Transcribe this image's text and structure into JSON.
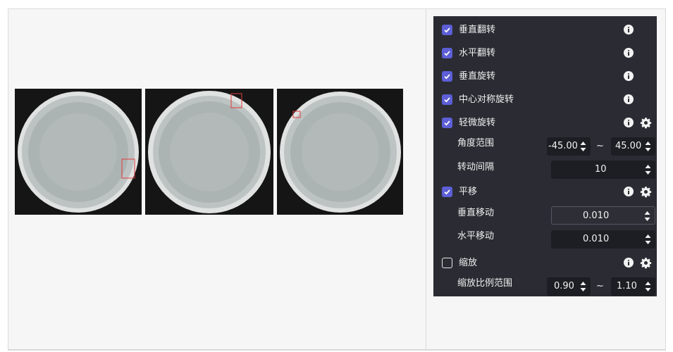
{
  "options": [
    {
      "id": "vflip",
      "label": "垂直翻转",
      "checked": true
    },
    {
      "id": "hflip",
      "label": "水平翻转",
      "checked": true
    },
    {
      "id": "vrotate",
      "label": "垂直旋转",
      "checked": true
    },
    {
      "id": "center_sym",
      "label": "中心对称旋转",
      "checked": true
    },
    {
      "id": "slight_rotate",
      "label": "轻微旋转",
      "checked": true,
      "params": {
        "angle_range": {
          "label": "角度范围",
          "min": "-45.00",
          "max": "45.00"
        },
        "interval": {
          "label": "转动间隔",
          "value": "10"
        }
      }
    },
    {
      "id": "translate",
      "label": "平移",
      "checked": true,
      "params": {
        "vertical": {
          "label": "垂直移动",
          "value": "0.010"
        },
        "horizontal": {
          "label": "水平移动",
          "value": "0.010"
        }
      }
    },
    {
      "id": "scale",
      "label": "缩放",
      "checked": false,
      "params": {
        "scale_range": {
          "label": "缩放比例范围",
          "min": "0.90",
          "max": "1.10"
        }
      }
    }
  ],
  "range_separator": "~",
  "colors": {
    "panel_bg": "#2b2c33",
    "checkbox_accent": "#5c5fd6",
    "input_bg": "#1d1e23",
    "marker": "#e03c3c"
  },
  "icons": [
    "info-icon",
    "gear-icon",
    "check-icon",
    "spin-arrows-icon"
  ]
}
